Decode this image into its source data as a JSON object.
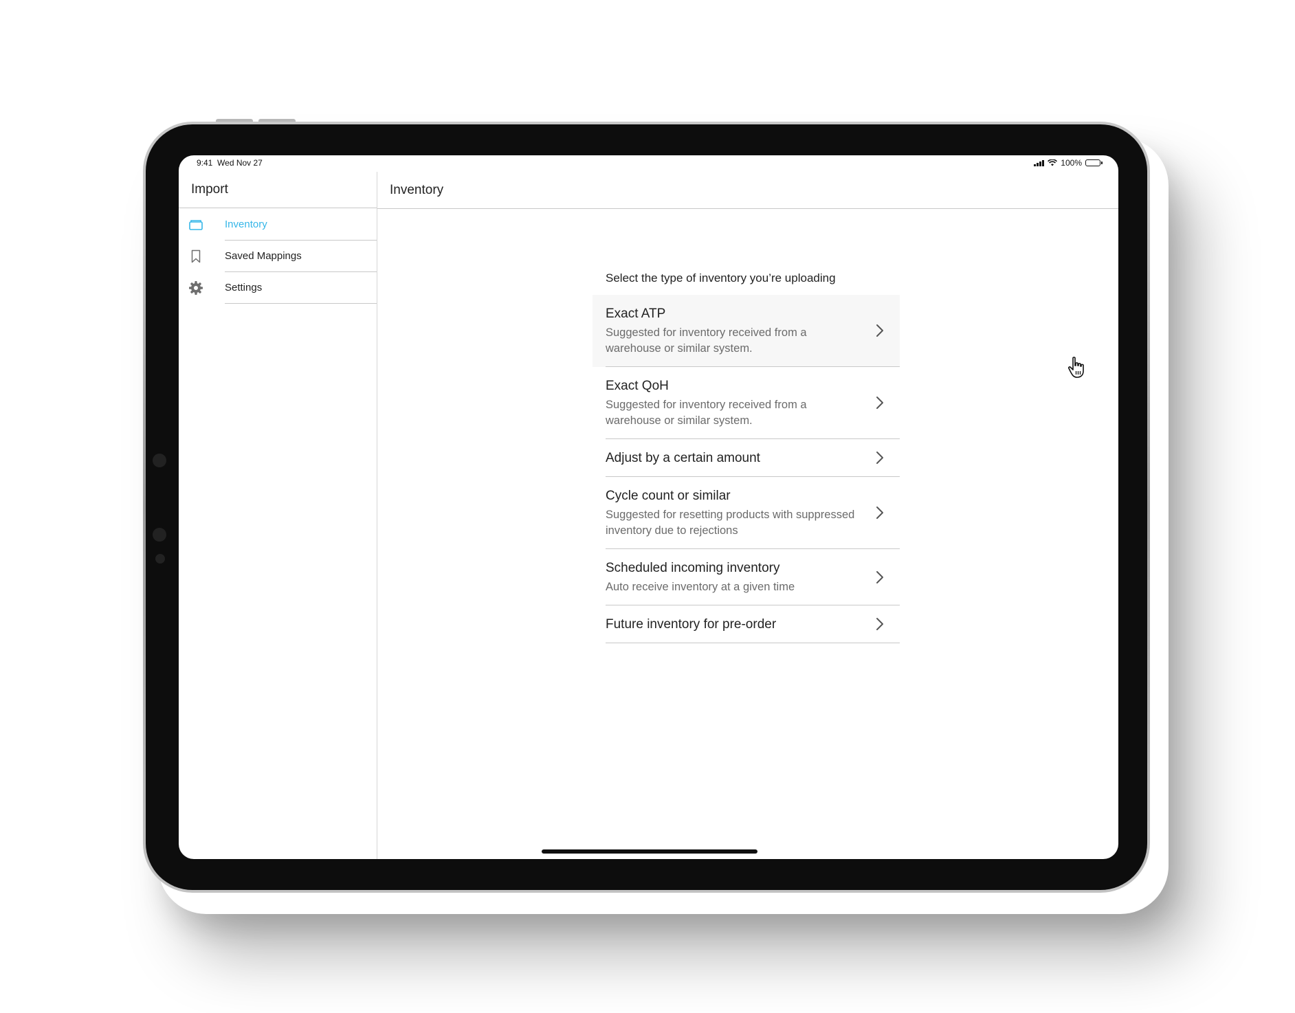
{
  "status_bar": {
    "time": "9:41",
    "date": "Wed Nov 27",
    "battery": "100%"
  },
  "sidebar": {
    "title": "Import",
    "items": [
      {
        "label": "Inventory",
        "icon": "folder-icon",
        "active": true
      },
      {
        "label": "Saved Mappings",
        "icon": "bookmark-icon",
        "active": false
      },
      {
        "label": "Settings",
        "icon": "gear-icon",
        "active": false
      }
    ]
  },
  "main": {
    "title": "Inventory",
    "prompt": "Select the type of inventory you’re uploading",
    "options": [
      {
        "title": "Exact ATP",
        "description": "Suggested for inventory received from a warehouse or similar system."
      },
      {
        "title": "Exact QoH",
        "description": "Suggested for inventory received from a warehouse or similar system."
      },
      {
        "title": "Adjust by a certain amount",
        "description": ""
      },
      {
        "title": "Cycle count or similar",
        "description": "Suggested for resetting products with suppressed inventory due to rejections"
      },
      {
        "title": "Scheduled incoming inventory",
        "description": "Auto receive inventory at a given time"
      },
      {
        "title": "Future inventory for pre-order",
        "description": ""
      }
    ]
  },
  "colors": {
    "accent": "#35b6e8",
    "text": "#222222",
    "muted": "#6b6b6b",
    "divider": "#c8c8c8"
  }
}
